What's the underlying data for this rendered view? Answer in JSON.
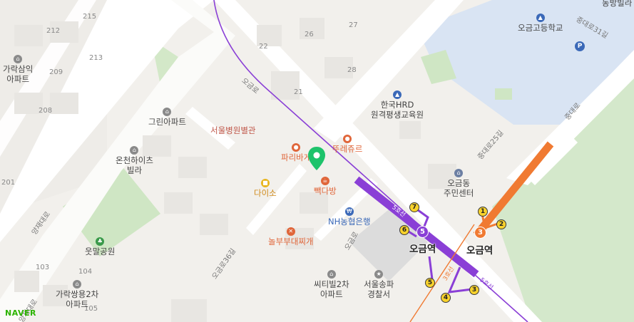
{
  "pois": {
    "apt_garaksamik": "가락삼익\n아파트",
    "green_apt": "그린아파트",
    "eoncheon_villa": "온천하이츠\n빌라",
    "wutmal_park": "웃말공원",
    "garak_ssangyong": "가락쌍용2차\n아파트",
    "seoul_hospital_annex": "서울병원별관",
    "paris_baguette": "파리바게",
    "daiso": "다이소",
    "paekdabang": "빽다방",
    "nh_bank": "NH농협은행",
    "nolbu": "놀부부대찌개",
    "citivil": "씨티빌2차\n아파트",
    "songpa_police": "서울송파\n경찰서",
    "tous_les_jours": "뚜레쥬르",
    "korea_hrd": "한국HRD\n원격평생교육원",
    "ogeum_center": "오금동\n주민센터",
    "ogeum_high": "오금고등학교",
    "dongbang_villa": "동방빌라"
  },
  "roads": {
    "ogeum_ro": "오금로",
    "ogeum_ro_2": "오금로",
    "yangjae_daero": "양재대로",
    "yangjae_daero_2": "양재대로",
    "ogeum_ro_36": "오금로36길",
    "jungdae_ro_25": "중대로25길",
    "jungdae_ro": "중대로",
    "jungdae_ro_31": "중대로31길",
    "line5_a": "5호선",
    "line5_b": "5호선",
    "line3": "3호선"
  },
  "building_numbers": [
    "215",
    "212",
    "213",
    "209",
    "208",
    "201",
    "26",
    "27",
    "22",
    "28",
    "21",
    "103",
    "104",
    "105"
  ],
  "stations": {
    "name_line5": "오금역",
    "name_line3": "오금역",
    "line5_badge": "5",
    "line3_badge": "3"
  },
  "exits": [
    "1",
    "2",
    "3",
    "4",
    "5",
    "6",
    "7"
  ],
  "colors": {
    "line5": "#8a3fd6",
    "line3": "#f07a32",
    "school": "#d9e4f3",
    "park": "#cfe6c4",
    "poi_orange": "#e0663a",
    "poi_blue": "#3b69b8",
    "marker": "#1ec36b"
  },
  "branding": {
    "logo": "NAVER"
  }
}
